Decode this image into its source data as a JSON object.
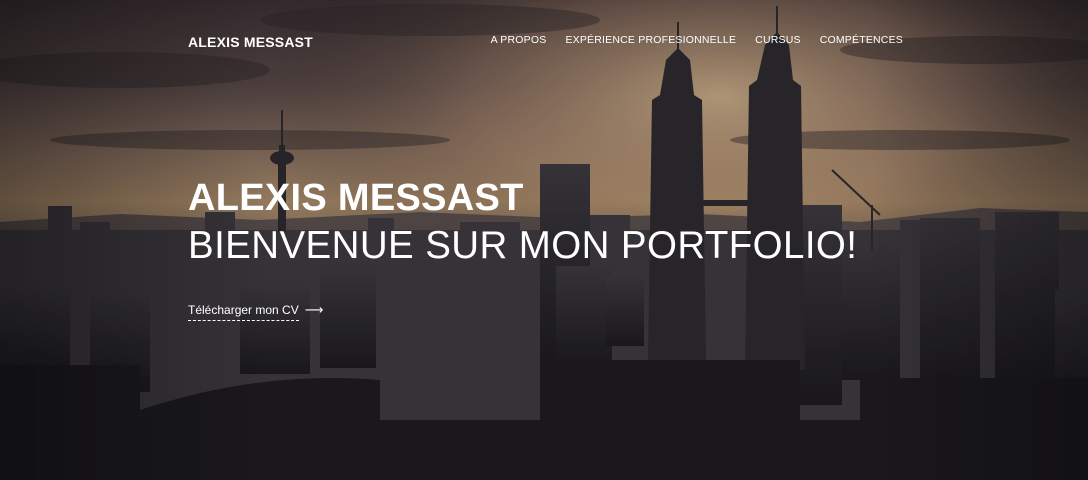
{
  "brand": "ALEXIS MESSAST",
  "nav": {
    "items": [
      {
        "label": "A PROPOS"
      },
      {
        "label": "EXPÉRIENCE PROFESIONNELLE"
      },
      {
        "label": "CURSUS"
      },
      {
        "label": "COMPÉTENCES"
      }
    ]
  },
  "hero": {
    "title": "ALEXIS MESSAST",
    "subtitle": "BIENVENUE SUR MON PORTFOLIO!",
    "cv_link_label": "Télécharger mon CV",
    "cv_link_arrow": "⟶",
    "background": "city-skyline-photo"
  }
}
